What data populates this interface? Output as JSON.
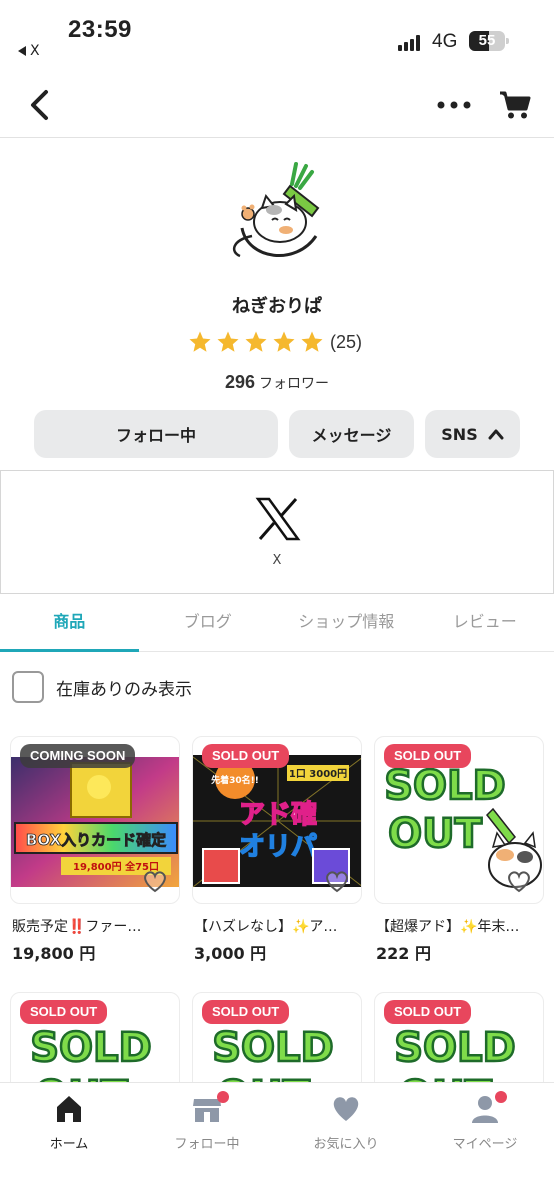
{
  "status_bar": {
    "time": "23:59",
    "back_app": "X",
    "network": "4G",
    "battery": "55"
  },
  "header": {
    "back_icon": "chevron-left-icon",
    "more_icon": "ellipsis-icon",
    "cart_icon": "cart-icon"
  },
  "shop": {
    "name": "ねぎおりぱ",
    "rating_stars": 5,
    "review_count": "(25)",
    "followers_count": "296",
    "followers_label": "フォロワー"
  },
  "buttons": {
    "follow": "フォロー中",
    "message": "メッセージ",
    "sns": "SNS"
  },
  "sns_panel": {
    "label": "X"
  },
  "tabs": [
    {
      "label": "商品",
      "active": true
    },
    {
      "label": "ブログ",
      "active": false
    },
    {
      "label": "ショップ情報",
      "active": false
    },
    {
      "label": "レビュー",
      "active": false
    }
  ],
  "filter": {
    "label": "在庫ありのみ表示",
    "checked": false
  },
  "products": [
    {
      "badge": "COMING SOON",
      "title": "販売予定‼️ファー…",
      "price": "19,800 円"
    },
    {
      "badge": "SOLD OUT",
      "title": "【ハズレなし】✨ア…",
      "price": "3,000 円"
    },
    {
      "badge": "SOLD OUT",
      "title": "【超爆アド】✨年末…",
      "price": "222 円"
    },
    {
      "badge": "SOLD OUT",
      "title": "",
      "price": ""
    },
    {
      "badge": "SOLD OUT",
      "title": "",
      "price": ""
    },
    {
      "badge": "SOLD OUT",
      "title": "",
      "price": ""
    }
  ],
  "thumb_text": {
    "p1_banner": "BOX入りカード確定",
    "p1_sub": "19,800円 全75口",
    "p2_top": "先着30名!!",
    "p2_price": "1口 3000円",
    "p2_main1": "アド確",
    "p2_main2": "オリパ",
    "soldout_1": "SOLD",
    "soldout_2": "OUT"
  },
  "bottom_nav": [
    {
      "label": "ホーム",
      "icon": "home-icon",
      "active": true
    },
    {
      "label": "フォロー中",
      "icon": "shop-icon",
      "active": false
    },
    {
      "label": "お気に入り",
      "icon": "heart-icon",
      "active": false
    },
    {
      "label": "マイページ",
      "icon": "person-icon",
      "active": false
    }
  ],
  "colors": {
    "accent": "#1fa7b8",
    "sold_out": "#e8465d",
    "star": "#f5b82e",
    "button_bg": "#e9eaeb"
  }
}
